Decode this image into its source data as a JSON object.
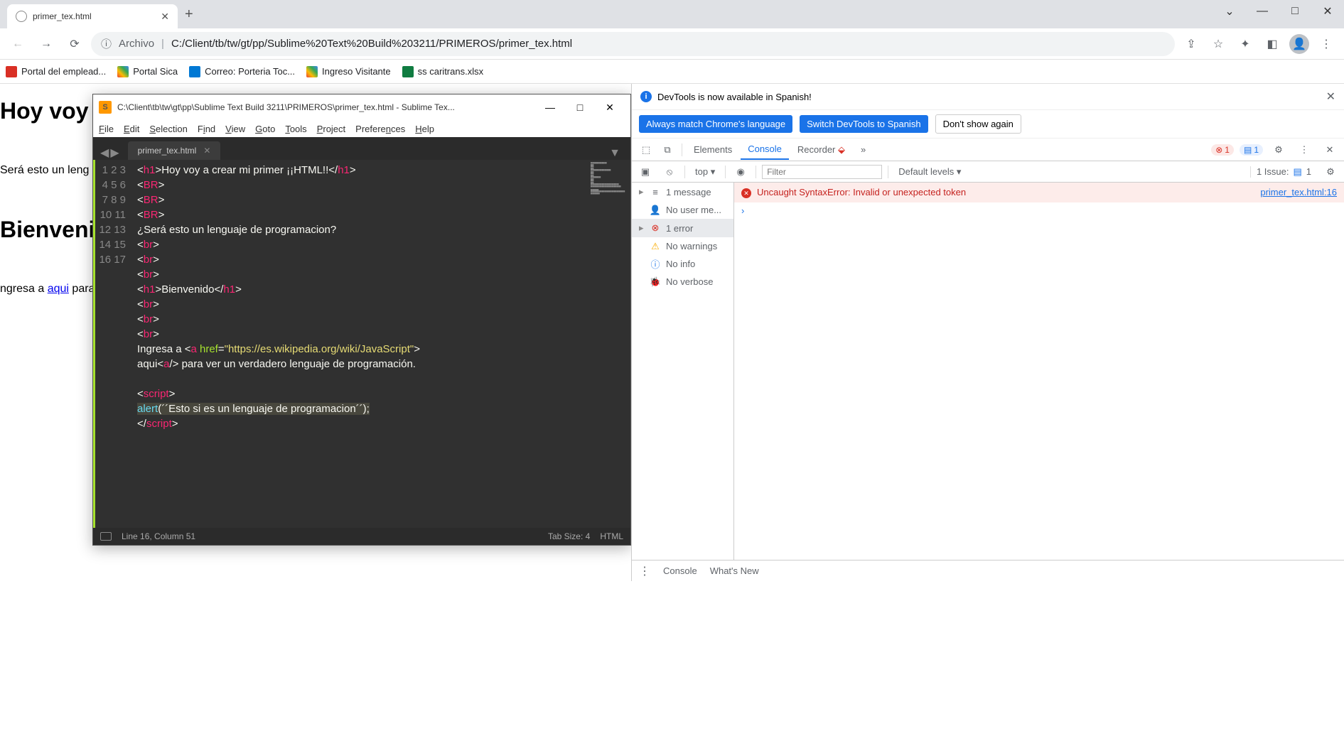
{
  "browser": {
    "tab_title": "primer_tex.html",
    "url_prefix": "Archivo",
    "url_path": "C:/Client/tb/tw/gt/pp/Sublime%20Text%20Build%203211/PRIMEROS/primer_tex.html"
  },
  "window_controls": {
    "caret": "⌄",
    "min": "—",
    "max": "□",
    "close": "✕"
  },
  "bookmarks": [
    {
      "label": "Portal del emplead...",
      "color": "#d93025"
    },
    {
      "label": "Portal Sica",
      "color": "#34a853"
    },
    {
      "label": "Correo: Porteria Toc...",
      "color": "#0078d4"
    },
    {
      "label": "Ingreso Visitante",
      "color": "#34a853"
    },
    {
      "label": "ss caritrans.xlsx",
      "color": "#107c41"
    }
  ],
  "page": {
    "h1a": "Hoy voy",
    "p1": "Será esto un leng",
    "h1b": "Bienveni",
    "p2_pre": "ngresa a ",
    "p2_link": "aqui",
    "p2_post": " para"
  },
  "sublime": {
    "title": "C:\\Client\\tb\\tw\\gt\\pp\\Sublime Text Build 3211\\PRIMEROS\\primer_tex.html - Sublime Tex...",
    "menu": [
      "File",
      "Edit",
      "Selection",
      "Find",
      "View",
      "Goto",
      "Tools",
      "Project",
      "Preferences",
      "Help"
    ],
    "tab": "primer_tex.html",
    "lines": [
      "1",
      "2",
      "3",
      "4",
      "5",
      "6",
      "7",
      "8",
      "9",
      "10",
      "11",
      "12",
      "13",
      "",
      "14",
      "15",
      "16",
      "17"
    ],
    "status_cursor": "Line 16, Column 51",
    "status_tab": "Tab Size: 4",
    "status_lang": "HTML",
    "code": {
      "l1_txt": "Hoy voy a crear mi primer ¡¡HTML!!",
      "l5": "¿Será esto un lenguaje de programacion?",
      "l9_txt": "Bienvenido",
      "l13a": "Ingresa a ",
      "l13_href": "\"https://es.wikipedia.org/wiki/JavaScript\"",
      "l13b": "aqui",
      "l13c": " para ver un verdadero lenguaje de programación.",
      "l16_fn": "alert",
      "l16_arg": "´´Esto si es un lenguaje de programacion´´"
    }
  },
  "devtools": {
    "banner": "DevTools is now available in Spanish!",
    "btn_always": "Always match Chrome's language",
    "btn_switch": "Switch DevTools to Spanish",
    "btn_dont": "Don't show again",
    "tabs": {
      "elements": "Elements",
      "console": "Console",
      "recorder": "Recorder"
    },
    "badges": {
      "err": "1",
      "msg": "1"
    },
    "filter": {
      "top": "top",
      "placeholder": "Filter",
      "levels": "Default levels",
      "issue": "1 Issue:",
      "issue_n": "1"
    },
    "sidebar": {
      "messages": "1 message",
      "user": "No user me...",
      "errors": "1 error",
      "warnings": "No warnings",
      "info": "No info",
      "verbose": "No verbose"
    },
    "error": {
      "text": "Uncaught SyntaxError: Invalid or unexpected token",
      "src": "primer_tex.html:16"
    },
    "footer": {
      "console": "Console",
      "whatsnew": "What's New"
    }
  }
}
